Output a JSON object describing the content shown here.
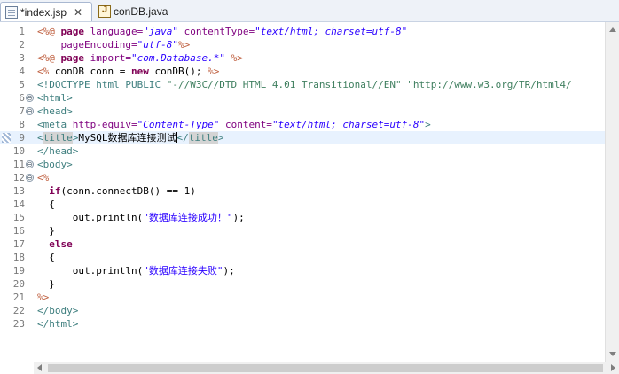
{
  "tabs": [
    {
      "label": "*index.jsp",
      "close": "✕",
      "icon": "jsp-file-icon",
      "active": true
    },
    {
      "label": "conDB.java",
      "icon": "java-file-icon",
      "active": false
    }
  ],
  "editor": {
    "current_line": 9,
    "lines": [
      {
        "n": "1",
        "fold": "",
        "tokens": [
          [
            "d",
            "<%@ "
          ],
          [
            "k",
            "page "
          ],
          [
            "a",
            "language="
          ],
          [
            "s",
            "\"java\""
          ],
          [
            "p",
            " "
          ],
          [
            "a",
            "contentType="
          ],
          [
            "s",
            "\"text/html; charset=utf-8\""
          ]
        ]
      },
      {
        "n": "2",
        "fold": "",
        "tokens": [
          [
            "p",
            "    "
          ],
          [
            "a",
            "pageEncoding="
          ],
          [
            "s",
            "\"utf-8\""
          ],
          [
            "d",
            "%>"
          ]
        ]
      },
      {
        "n": "3",
        "fold": "",
        "tokens": [
          [
            "d",
            "<%@ "
          ],
          [
            "k",
            "page "
          ],
          [
            "a",
            "import="
          ],
          [
            "s",
            "\"com.Database.*\""
          ],
          [
            "p",
            " "
          ],
          [
            "d",
            "%>"
          ]
        ]
      },
      {
        "n": "4",
        "fold": "",
        "tokens": [
          [
            "d",
            "<% "
          ],
          [
            "p",
            "conDB conn = "
          ],
          [
            "k",
            "new "
          ],
          [
            "p",
            "conDB(); "
          ],
          [
            "d",
            "%>"
          ]
        ]
      },
      {
        "n": "5",
        "fold": "",
        "tokens": [
          [
            "t",
            "<!DOCTYPE html PUBLIC "
          ],
          [
            "ds",
            "\"-//W3C//DTD HTML 4.01 Transitional//EN\" \"http://www.w3.org/TR/html4/"
          ]
        ]
      },
      {
        "n": "6",
        "fold": "⊖",
        "tokens": [
          [
            "t",
            "<html>"
          ]
        ]
      },
      {
        "n": "7",
        "fold": "⊖",
        "tokens": [
          [
            "t",
            "<head>"
          ]
        ]
      },
      {
        "n": "8",
        "fold": "",
        "tokens": [
          [
            "t",
            "<meta "
          ],
          [
            "a",
            "http-equiv="
          ],
          [
            "s",
            "\"Content-Type\""
          ],
          [
            "p",
            " "
          ],
          [
            "a",
            "content="
          ],
          [
            "s",
            "\"text/html; charset=utf-8\""
          ],
          [
            "t",
            ">"
          ]
        ]
      },
      {
        "n": "9",
        "fold": "",
        "tokens": [
          [
            "t",
            "<"
          ],
          [
            "th",
            "title"
          ],
          [
            "t",
            ">"
          ],
          [
            "p",
            "MySQL数据库连接测试"
          ],
          [
            "caret",
            ""
          ],
          [
            "t",
            "</"
          ],
          [
            "th",
            "title"
          ],
          [
            "t",
            ">"
          ]
        ]
      },
      {
        "n": "10",
        "fold": "",
        "tokens": [
          [
            "t",
            "</head>"
          ]
        ]
      },
      {
        "n": "11",
        "fold": "⊖",
        "tokens": [
          [
            "t",
            "<body>"
          ]
        ]
      },
      {
        "n": "12",
        "fold": "⊖",
        "tokens": [
          [
            "d",
            "<%"
          ]
        ]
      },
      {
        "n": "13",
        "fold": "",
        "tokens": [
          [
            "p",
            "  "
          ],
          [
            "k",
            "if"
          ],
          [
            "p",
            "(conn.connectDB() == 1)"
          ]
        ]
      },
      {
        "n": "14",
        "fold": "",
        "tokens": [
          [
            "p",
            "  {"
          ]
        ]
      },
      {
        "n": "15",
        "fold": "",
        "tokens": [
          [
            "p",
            "      out.println("
          ],
          [
            "j",
            "\"数据库连接成功！\""
          ],
          [
            "p",
            ");"
          ]
        ]
      },
      {
        "n": "16",
        "fold": "",
        "tokens": [
          [
            "p",
            "  }"
          ]
        ]
      },
      {
        "n": "17",
        "fold": "",
        "tokens": [
          [
            "p",
            "  "
          ],
          [
            "k",
            "else"
          ]
        ]
      },
      {
        "n": "18",
        "fold": "",
        "tokens": [
          [
            "p",
            "  {"
          ]
        ]
      },
      {
        "n": "19",
        "fold": "",
        "tokens": [
          [
            "p",
            "      out.println("
          ],
          [
            "j",
            "\"数据库连接失败\""
          ],
          [
            "p",
            ");"
          ]
        ]
      },
      {
        "n": "20",
        "fold": "",
        "tokens": [
          [
            "p",
            "  }"
          ]
        ]
      },
      {
        "n": "21",
        "fold": "",
        "tokens": [
          [
            "d",
            "%>"
          ]
        ]
      },
      {
        "n": "22",
        "fold": "",
        "tokens": [
          [
            "t",
            "</body>"
          ]
        ]
      },
      {
        "n": "23",
        "fold": "",
        "tokens": [
          [
            "t",
            "</html>"
          ]
        ]
      }
    ]
  }
}
